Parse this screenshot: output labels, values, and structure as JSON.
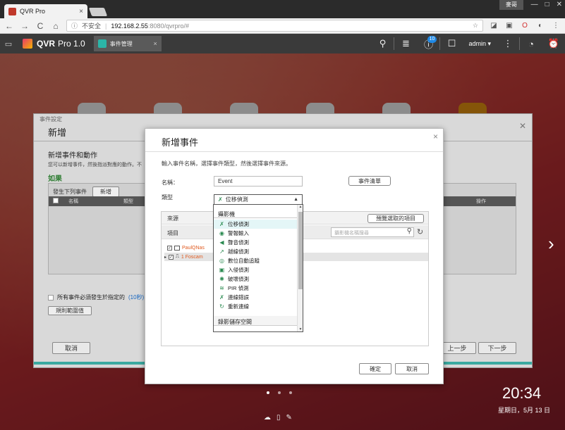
{
  "browser": {
    "tab_title": "QVR Pro",
    "tab_close": "×",
    "user_badge": "麥哥",
    "win_minimize": "—",
    "win_maximize": "□",
    "win_close": "✕",
    "back": "←",
    "forward": "→",
    "reload": "C",
    "home": "⌂",
    "security_label": "不安全",
    "url_host": "192.168.2.55",
    "url_path": ":8080/qvrpro/#"
  },
  "app": {
    "name": "QVR",
    "version": "Pro 1.0",
    "tab_label": "事件管理",
    "tab_close": "×",
    "notification_count": "10",
    "user": "admin"
  },
  "wizard": {
    "top_title": "事件設定",
    "title": "新增",
    "subtitle": "新增事件和動作",
    "description": "您可以新增事件，然後指派對應的動作。不",
    "if_label": "如果",
    "occur_label": "發生下列事件",
    "add_button": "新增",
    "col_name": "名稱",
    "col_type": "類型",
    "col_action": "操作",
    "alltime_text": "所有事件必須發生於指定的",
    "alltime_link": "(10秒)",
    "alltime_suffix": "期間",
    "rule_button": "規則範圍值",
    "cancel_button": "取消",
    "prev_button": "上一步",
    "next_button": "下一步"
  },
  "dialog": {
    "title": "新增事件",
    "close": "×",
    "description": "輸入事件名稱，選擇事件類型，然後選擇事件來源。",
    "name_label": "名稱：",
    "name_value": "Event",
    "event_list_button": "事件清單",
    "type_label": "類型",
    "type_selected": "位移偵測",
    "source_title": "來源",
    "preview_button": "預覽選取的項目",
    "item_col": "項目",
    "search_placeholder": "攝影機名稱搜尋",
    "tree": [
      {
        "label": "PaulQNas"
      },
      {
        "label": "1 Foscam"
      }
    ],
    "ok_button": "確定",
    "cancel_button": "取消"
  },
  "dropdown": {
    "group1": "攝影機",
    "items": [
      {
        "label": "位移偵測",
        "icon": "motion-icon",
        "glyph": "✗"
      },
      {
        "label": "警報輸入",
        "icon": "alarm-input-icon",
        "glyph": "◉"
      },
      {
        "label": "聲音偵測",
        "icon": "audio-icon",
        "glyph": "◀"
      },
      {
        "label": "越線偵測",
        "icon": "line-crossing-icon",
        "glyph": "↗"
      },
      {
        "label": "數位自動追蹤",
        "icon": "tracking-icon",
        "glyph": "◎"
      },
      {
        "label": "入侵偵測",
        "icon": "intrusion-icon",
        "glyph": "▣"
      },
      {
        "label": "破壞偵測",
        "icon": "tamper-icon",
        "glyph": "✺"
      },
      {
        "label": "PIR 偵測",
        "icon": "pir-icon",
        "glyph": "≋"
      },
      {
        "label": "連線錯誤",
        "icon": "connection-error-icon",
        "glyph": "✗"
      },
      {
        "label": "重新連線",
        "icon": "reconnect-icon",
        "glyph": "↻"
      }
    ],
    "group2": "錄影儲存空間"
  },
  "desktop": {
    "time": "20:34",
    "date": "星期日，5月 13 日"
  }
}
